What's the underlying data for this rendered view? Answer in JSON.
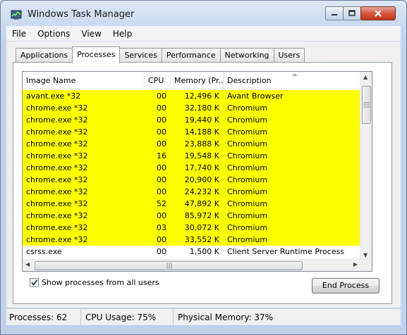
{
  "window": {
    "title": "Windows Task Manager",
    "icon": "task-manager-icon"
  },
  "menu": [
    "File",
    "Options",
    "View",
    "Help"
  ],
  "tabs": [
    "Applications",
    "Processes",
    "Services",
    "Performance",
    "Networking",
    "Users"
  ],
  "active_tab": "Processes",
  "columns": [
    "Image Name",
    "CPU",
    "Memory (Pr...",
    "Description"
  ],
  "sort_column": "Description",
  "highlight_color": "#ffff00",
  "rows": [
    {
      "name": "avant.exe *32",
      "cpu": "00",
      "mem": "12,496 K",
      "desc": "Avant Browser",
      "highlighted": true
    },
    {
      "name": "chrome.exe *32",
      "cpu": "00",
      "mem": "32,180 K",
      "desc": "Chromium",
      "highlighted": true
    },
    {
      "name": "chrome.exe *32",
      "cpu": "00",
      "mem": "19,440 K",
      "desc": "Chromium",
      "highlighted": true
    },
    {
      "name": "chrome.exe *32",
      "cpu": "00",
      "mem": "14,188 K",
      "desc": "Chromium",
      "highlighted": true
    },
    {
      "name": "chrome.exe *32",
      "cpu": "00",
      "mem": "23,888 K",
      "desc": "Chromium",
      "highlighted": true
    },
    {
      "name": "chrome.exe *32",
      "cpu": "16",
      "mem": "19,548 K",
      "desc": "Chromium",
      "highlighted": true
    },
    {
      "name": "chrome.exe *32",
      "cpu": "00",
      "mem": "17,740 K",
      "desc": "Chromium",
      "highlighted": true
    },
    {
      "name": "chrome.exe *32",
      "cpu": "00",
      "mem": "20,900 K",
      "desc": "Chromium",
      "highlighted": true
    },
    {
      "name": "chrome.exe *32",
      "cpu": "00",
      "mem": "24,232 K",
      "desc": "Chromium",
      "highlighted": true
    },
    {
      "name": "chrome.exe *32",
      "cpu": "52",
      "mem": "47,892 K",
      "desc": "Chromium",
      "highlighted": true
    },
    {
      "name": "chrome.exe *32",
      "cpu": "00",
      "mem": "85,972 K",
      "desc": "Chromium",
      "highlighted": true
    },
    {
      "name": "chrome.exe *32",
      "cpu": "03",
      "mem": "30,072 K",
      "desc": "Chromium",
      "highlighted": true
    },
    {
      "name": "chrome.exe *32",
      "cpu": "00",
      "mem": "33,552 K",
      "desc": "Chromium",
      "highlighted": true
    },
    {
      "name": "csrss.exe",
      "cpu": "00",
      "mem": "1,500 K",
      "desc": "Client Server Runtime Process",
      "highlighted": false
    }
  ],
  "show_all_users": {
    "label": "Show processes from all users",
    "checked": true
  },
  "end_process_label": "End Process",
  "status": {
    "processes": "Processes: 62",
    "cpu_usage": "CPU Usage: 75%",
    "physical_memory": "Physical Memory: 37%"
  }
}
